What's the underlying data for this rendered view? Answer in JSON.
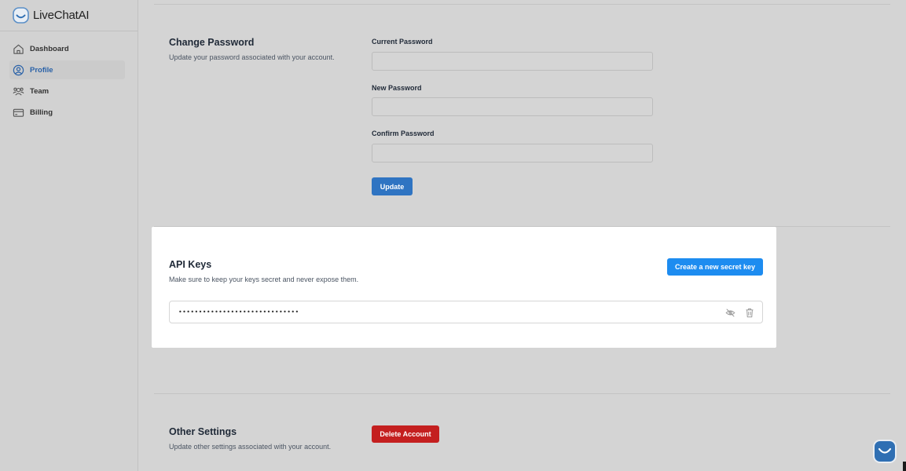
{
  "brand": {
    "name": "LiveChatAI",
    "logo_icon": "livechatai-logo-icon",
    "accent": "#2f74c2"
  },
  "sidebar": {
    "items": [
      {
        "label": "Dashboard",
        "icon": "home-icon",
        "active": false
      },
      {
        "label": "Profile",
        "icon": "user-circle-icon",
        "active": true
      },
      {
        "label": "Team",
        "icon": "team-icon",
        "active": false
      },
      {
        "label": "Billing",
        "icon": "credit-card-icon",
        "active": false
      }
    ]
  },
  "change_password": {
    "title": "Change Password",
    "subtitle": "Update your password associated with your account.",
    "current_label": "Current Password",
    "current_value": "",
    "new_label": "New Password",
    "new_value": "",
    "confirm_label": "Confirm Password",
    "confirm_value": "",
    "update_button": "Update"
  },
  "api_keys": {
    "title": "API Keys",
    "subtitle": "Make sure to keep your keys secret and never expose them.",
    "create_button": "Create a new secret key",
    "key_masked": "••••••••••••••••••••••••••••••",
    "toggle_icon": "eye-off-icon",
    "delete_icon": "trash-icon"
  },
  "other_settings": {
    "title": "Other Settings",
    "subtitle": "Update other settings associated with your account.",
    "delete_button": "Delete Account"
  },
  "chat_widget": {
    "icon": "chat-smile-icon"
  }
}
